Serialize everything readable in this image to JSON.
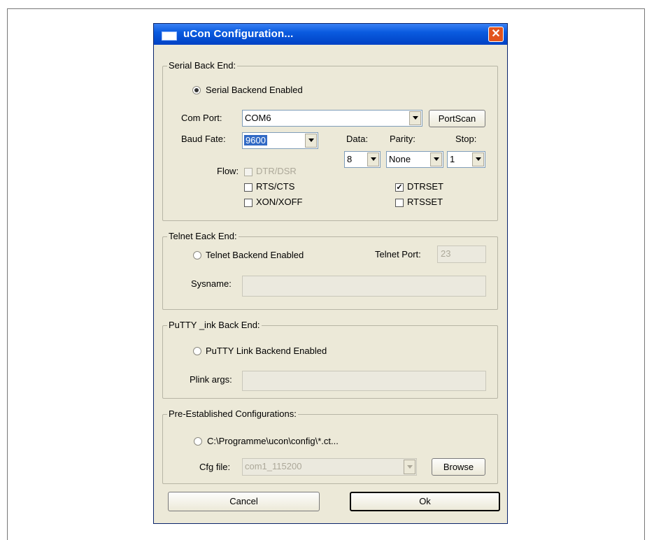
{
  "window": {
    "title": "uCon Configuration...",
    "close_symbol": "✕"
  },
  "serial": {
    "legend": "Serial Back End:",
    "enabled_label": "Serial Backend Enabled",
    "com_port_label": "Com Port:",
    "com_port_value": "COM6",
    "portscan_label": "PortScan",
    "baud_label": "Baud Fate:",
    "baud_value": "9600",
    "data_label": "Data:",
    "data_value": "8",
    "parity_label": "Parity:",
    "parity_value": "None",
    "stop_label": "Stop:",
    "stop_value": "1",
    "flow_label": "Flow:",
    "dtr_dsr_label": "DTR/DSR",
    "rts_cts_label": "RTS/CTS",
    "xon_xoff_label": "XON/XOFF",
    "dtrset_label": "DTRSET",
    "dtrset_mark": "✓",
    "rtsset_label": "RTSSET"
  },
  "telnet": {
    "legend": "Telnet Eack End:",
    "enabled_label": "Telnet Backend Enabled",
    "port_label": "Telnet Port:",
    "port_value": "23",
    "sysname_label": "Sysname:"
  },
  "putty": {
    "legend": "PuTTY _ink Back End:",
    "enabled_label": "PuTTY Link Backend Enabled",
    "plink_label": "Plink args:"
  },
  "preset": {
    "legend": "Pre-Established Configurations:",
    "path_label": "C:\\Programme\\ucon\\config\\*.ct...",
    "cfg_label": "Cfg file:",
    "cfg_value": "com1_115200",
    "browse_label": "Browse"
  },
  "buttons": {
    "cancel_label": "Cancel",
    "ok_label": "Ok"
  }
}
